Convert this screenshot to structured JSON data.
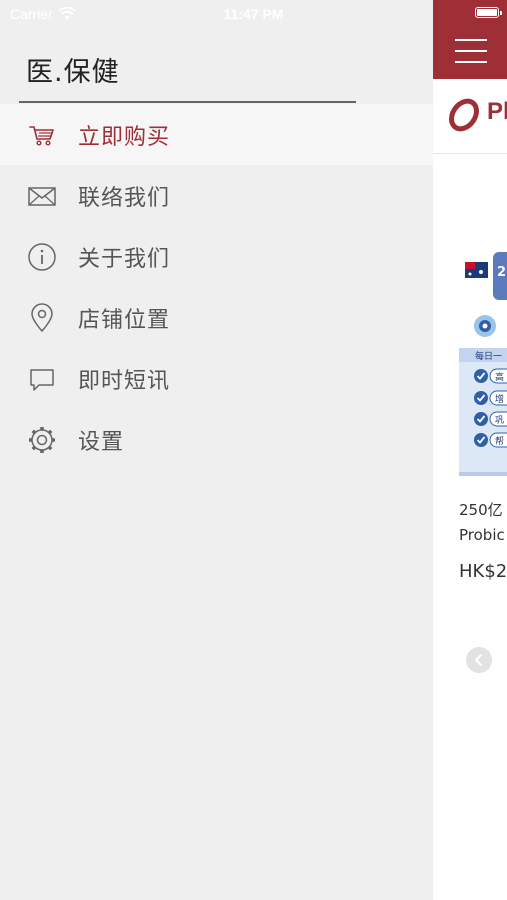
{
  "status_bar": {
    "carrier": "Carrier",
    "time": "11:47 PM"
  },
  "drawer": {
    "title": "医.保健",
    "items": [
      {
        "label": "立即购买",
        "icon": "cart-icon",
        "active": true
      },
      {
        "label": "联络我们",
        "icon": "mail-icon",
        "active": false
      },
      {
        "label": "关于我们",
        "icon": "info-icon",
        "active": false
      },
      {
        "label": "店铺位置",
        "icon": "location-pin-icon",
        "active": false
      },
      {
        "label": "即时短讯",
        "icon": "chat-bubble-icon",
        "active": false
      },
      {
        "label": "设置",
        "icon": "gear-icon",
        "active": false
      }
    ]
  },
  "main": {
    "logo_text": "Pl",
    "product": {
      "name_line1": "250亿",
      "name_line2": "Probic",
      "price": "HK$2",
      "badge_number": "2",
      "panel_heading": "每日一",
      "checklist": [
        "高",
        "增",
        "巩",
        "帮"
      ]
    }
  },
  "colors": {
    "accent": "#9e2f36",
    "drawer_bg": "#efefef",
    "active_row_bg": "#f6f6f6"
  }
}
